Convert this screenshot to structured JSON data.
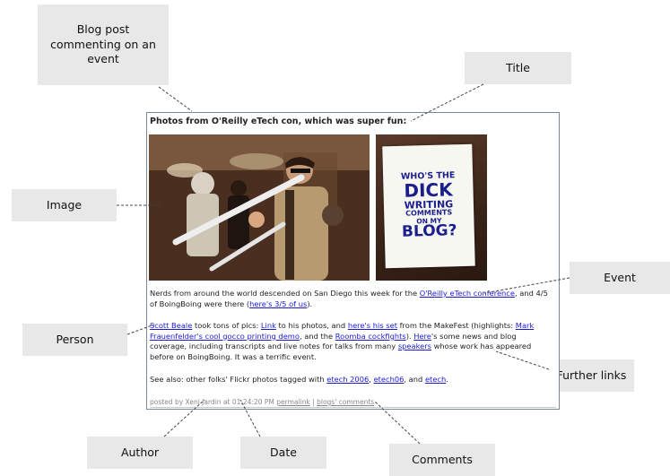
{
  "callouts": {
    "blog_post": "Blog post commenting on an event",
    "title": "Title",
    "image": "Image",
    "event": "Event",
    "person": "Person",
    "further_links": "Further links",
    "author": "Author",
    "date": "Date",
    "comments": "Comments"
  },
  "post": {
    "title": "Photos from O'Reilly eTech con, which was super fun:",
    "sign_lines": [
      "WHO'S THE",
      "DICK",
      "WRITING",
      "COMMENTS",
      "ON MY",
      "BLOG?"
    ],
    "p1": {
      "t1": "Nerds from around the world descended on San Diego this week for the ",
      "link1": "O'Reilly eTech conference",
      "t2": ", and 4/5 of BoingBoing were there (",
      "link2": "here's 3/5 of us",
      "t3": ")."
    },
    "p2": {
      "link1": "Scott Beale",
      "t1": " took tons of pics: ",
      "link2": "Link",
      "t2": " to his photos, and ",
      "link3": "here's his set",
      "t3": " from the MakeFest (highlights: ",
      "link4": "Mark Frauenfelder's cool gocco printing demo",
      "t4": ", and the ",
      "link5": "Roomba cockfights",
      "t5": "). ",
      "link6": "Here",
      "t6": "'s some news and blog coverage, including transcripts and live notes for talks from many ",
      "link7": "speakers",
      "t7": " whose work has appeared before on BoingBoing. It was a terrific event."
    },
    "p3": {
      "t1": "See also: other folks' Flickr photos tagged with ",
      "link1": "etech 2006",
      "t2": ", ",
      "link2": "etech06",
      "t3": ", and ",
      "link3": "etech",
      "t4": "."
    },
    "meta": {
      "t1": "posted by Xeni Jardin at 01:24:20 PM ",
      "permalink": "permalink",
      "sep": " | ",
      "comments": "blogs' comments"
    }
  }
}
